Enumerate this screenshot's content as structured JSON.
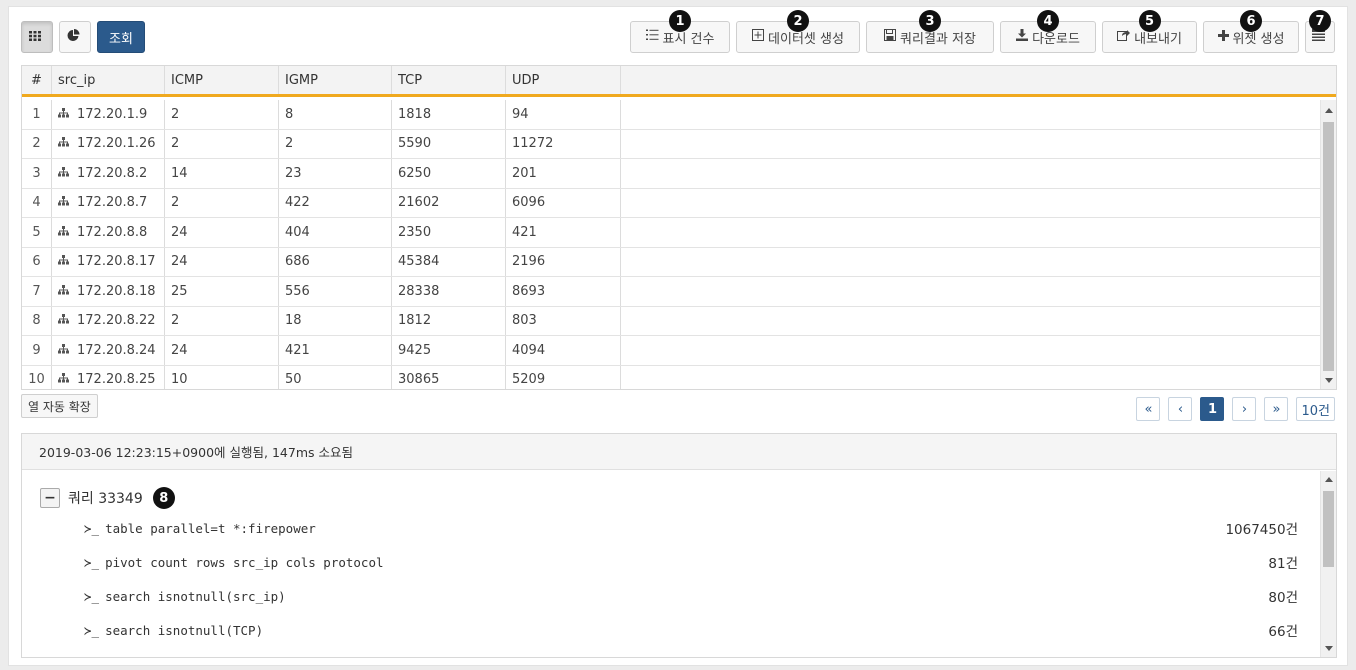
{
  "toolbar": {
    "left": {
      "grid_view_icon": "grid-icon",
      "chart_view_icon": "pie-chart-icon",
      "search_label": "조회"
    },
    "right": [
      {
        "badge": "1",
        "icon": "list-ordered-icon",
        "label": "표시 건수"
      },
      {
        "badge": "2",
        "icon": "plus-square-icon",
        "label": "데이터셋 생성"
      },
      {
        "badge": "3",
        "icon": "save-icon",
        "label": "쿼리결과 저장"
      },
      {
        "badge": "4",
        "icon": "download-icon",
        "label": "다운로드"
      },
      {
        "badge": "5",
        "icon": "share-icon",
        "label": "내보내기"
      },
      {
        "badge": "6",
        "icon": "plus-icon",
        "label": "위젯 생성"
      },
      {
        "badge": "7",
        "icon": "table-list-icon",
        "label": ""
      }
    ]
  },
  "table": {
    "columns": [
      "#",
      "src_ip",
      "ICMP",
      "IGMP",
      "TCP",
      "UDP"
    ],
    "rows": [
      [
        "1",
        "172.20.1.9",
        "2",
        "8",
        "1818",
        "94"
      ],
      [
        "2",
        "172.20.1.26",
        "2",
        "2",
        "5590",
        "11272"
      ],
      [
        "3",
        "172.20.8.2",
        "14",
        "23",
        "6250",
        "201"
      ],
      [
        "4",
        "172.20.8.7",
        "2",
        "422",
        "21602",
        "6096"
      ],
      [
        "5",
        "172.20.8.8",
        "24",
        "404",
        "2350",
        "421"
      ],
      [
        "6",
        "172.20.8.17",
        "24",
        "686",
        "45384",
        "2196"
      ],
      [
        "7",
        "172.20.8.18",
        "25",
        "556",
        "28338",
        "8693"
      ],
      [
        "8",
        "172.20.8.22",
        "2",
        "18",
        "1812",
        "803"
      ],
      [
        "9",
        "172.20.8.24",
        "24",
        "421",
        "9425",
        "4094"
      ],
      [
        "10",
        "172.20.8.25",
        "10",
        "50",
        "30865",
        "5209"
      ]
    ],
    "header_accent": "#f0a91e"
  },
  "auto_expand_label": "열 자동 확장",
  "pager": {
    "first": "«",
    "prev": "‹",
    "current": "1",
    "next": "›",
    "last": "»",
    "page_size": "10건"
  },
  "query": {
    "status": "2019-03-06 12:23:15+0900에 실행됨, 147ms 소요됨",
    "collapse_symbol": "−",
    "title": "쿼리 33349",
    "badge": "8",
    "prompt": "≻_",
    "commands": [
      {
        "text": "table parallel=t *:firepower",
        "count": "1067450건"
      },
      {
        "text": "pivot count rows src_ip cols protocol",
        "count": "81건"
      },
      {
        "text": "search isnotnull(src_ip)",
        "count": "80건"
      },
      {
        "text": "search isnotnull(TCP)",
        "count": "66건"
      }
    ]
  },
  "colors": {
    "primary": "#2b5a8c",
    "accent": "#f0a91e"
  }
}
